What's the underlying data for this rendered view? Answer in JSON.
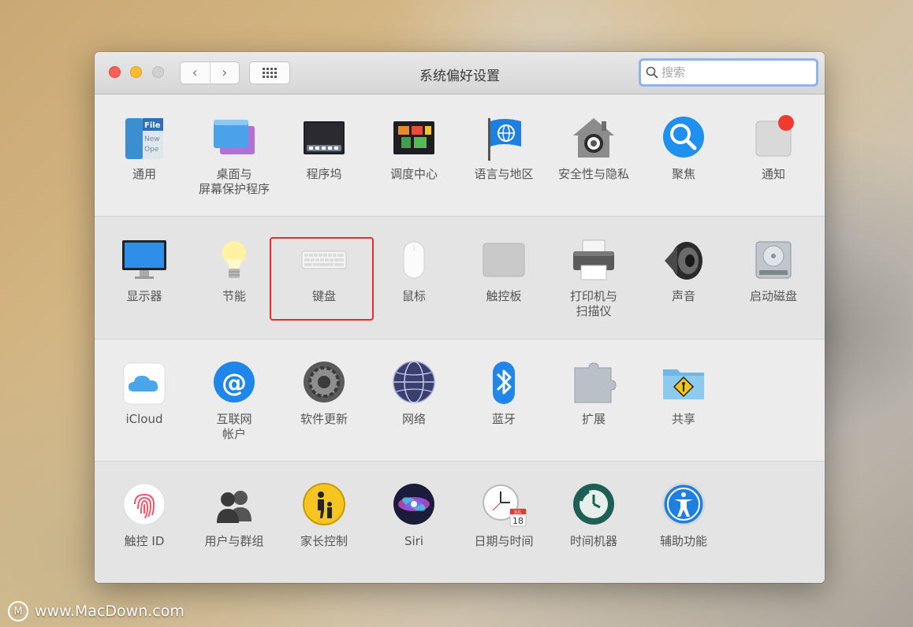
{
  "window": {
    "title": "系统偏好设置",
    "nav_back": "‹",
    "nav_forward": "›",
    "search_placeholder": "搜索"
  },
  "sections": [
    {
      "items": [
        {
          "label": "通用",
          "icon": "general-icon"
        },
        {
          "label": "桌面与\n屏幕保护程序",
          "icon": "desktop-screensaver-icon"
        },
        {
          "label": "程序坞",
          "icon": "dock-icon"
        },
        {
          "label": "调度中心",
          "icon": "mission-control-icon"
        },
        {
          "label": "语言与地区",
          "icon": "language-region-icon"
        },
        {
          "label": "安全性与隐私",
          "icon": "security-privacy-icon"
        },
        {
          "label": "聚焦",
          "icon": "spotlight-icon"
        },
        {
          "label": "通知",
          "icon": "notifications-icon"
        }
      ]
    },
    {
      "items": [
        {
          "label": "显示器",
          "icon": "displays-icon"
        },
        {
          "label": "节能",
          "icon": "energy-saver-icon"
        },
        {
          "label": "键盘",
          "icon": "keyboard-icon"
        },
        {
          "label": "鼠标",
          "icon": "mouse-icon"
        },
        {
          "label": "触控板",
          "icon": "trackpad-icon"
        },
        {
          "label": "打印机与\n扫描仪",
          "icon": "printers-scanners-icon"
        },
        {
          "label": "声音",
          "icon": "sound-icon"
        },
        {
          "label": "启动磁盘",
          "icon": "startup-disk-icon"
        }
      ]
    },
    {
      "items": [
        {
          "label": "iCloud",
          "icon": "icloud-icon"
        },
        {
          "label": "互联网\n帐户",
          "icon": "internet-accounts-icon"
        },
        {
          "label": "软件更新",
          "icon": "software-update-icon"
        },
        {
          "label": "网络",
          "icon": "network-icon"
        },
        {
          "label": "蓝牙",
          "icon": "bluetooth-icon"
        },
        {
          "label": "扩展",
          "icon": "extensions-icon"
        },
        {
          "label": "共享",
          "icon": "sharing-icon"
        }
      ]
    },
    {
      "items": [
        {
          "label": "触控 ID",
          "icon": "touch-id-icon"
        },
        {
          "label": "用户与群组",
          "icon": "users-groups-icon"
        },
        {
          "label": "家长控制",
          "icon": "parental-controls-icon"
        },
        {
          "label": "Siri",
          "icon": "siri-icon"
        },
        {
          "label": "日期与时间",
          "icon": "date-time-icon"
        },
        {
          "label": "时间机器",
          "icon": "time-machine-icon"
        },
        {
          "label": "辅助功能",
          "icon": "accessibility-icon"
        }
      ]
    }
  ],
  "icon_text": {
    "general_file": "File",
    "general_new": "New",
    "general_ope": "Ope",
    "calendar_month": "JUL",
    "calendar_day": "18"
  },
  "highlight": {
    "target": "键盘",
    "color": "#e0302b"
  },
  "watermark": {
    "logo": "M",
    "text": "www.MacDown.com"
  }
}
